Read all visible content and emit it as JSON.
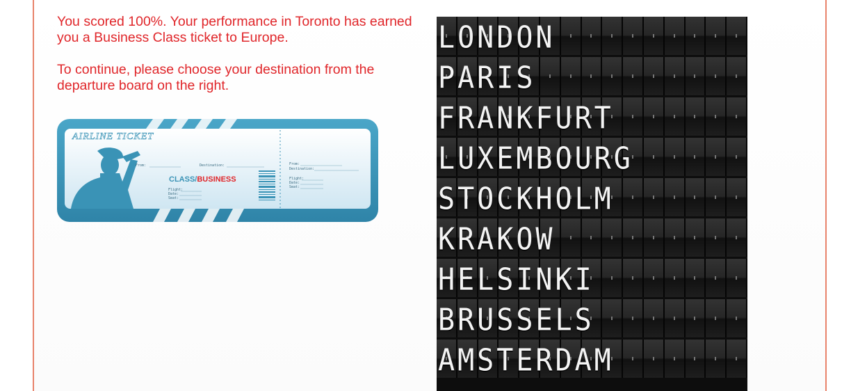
{
  "message": {
    "line1": "You scored 100%. Your performance in Toronto has earned you a Business Class ticket to Europe.",
    "line2": "To continue, please choose your destination from the departure board on the right."
  },
  "ticket": {
    "header": "AIRLINE TICKET",
    "from_label": "From:",
    "destination_label": "Destination:",
    "class_label": "CLASS/",
    "class_value": "BUSINESS",
    "flight_label": "Flight:",
    "date_label": "Date:",
    "seat_label": "Seat:",
    "stub_from_label": "From:",
    "stub_destination_label": "Destination:",
    "stub_flight_label": "Flight:",
    "stub_date_label": "Date:",
    "stub_seat_label": "Seat:"
  },
  "board": {
    "destinations": [
      "LONDON",
      "PARIS",
      "FRANKFURT",
      "LUXEMBOURG",
      "STOCKHOLM",
      "KRAKOW",
      "HELSINKI",
      "BRUSSELS",
      "AMSTERDAM"
    ]
  },
  "colors": {
    "message_text": "#e0262a",
    "frame_line": "#e8826a",
    "ticket_blue": "#3a93b6",
    "board_bg": "#0d0d0d"
  }
}
